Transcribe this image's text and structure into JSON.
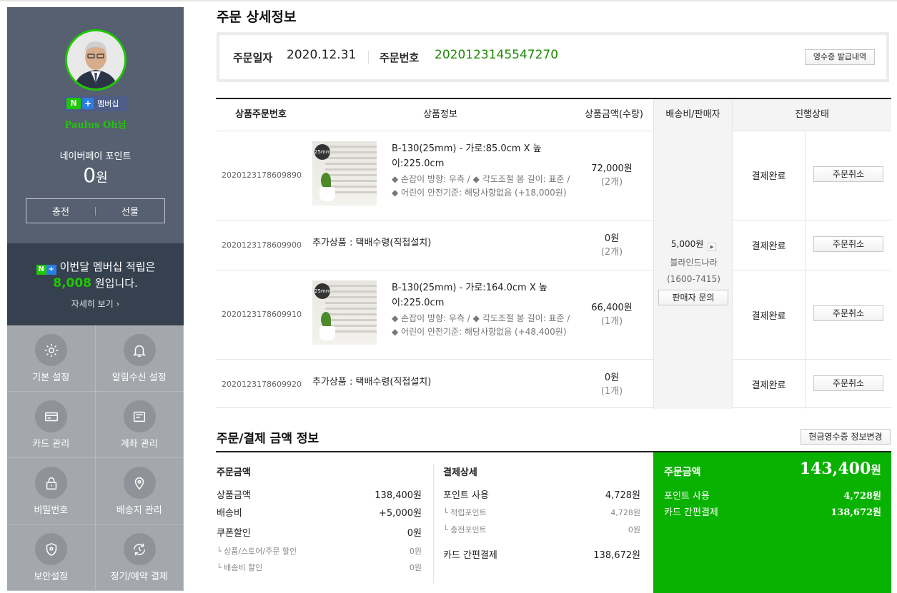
{
  "sidebar": {
    "badge": {
      "n": "N",
      "plus": "+",
      "label": "멤버십"
    },
    "username": "Paulus Oh님",
    "points_label": "네이버페이 포인트",
    "points_value": "0",
    "points_unit": "원",
    "charge": "충전",
    "gift": "선물",
    "membership": {
      "line1": "이번달 멤버십 적립은",
      "amount": "8,008",
      "line2_suffix": "원입니다.",
      "more": "자세히 보기 ›"
    },
    "menu": [
      {
        "label": "기본 설정",
        "icon": "gear-icon"
      },
      {
        "label": "알림수신 설정",
        "icon": "bell-icon"
      },
      {
        "label": "카드 관리",
        "icon": "card-icon"
      },
      {
        "label": "계좌 관리",
        "icon": "account-icon"
      },
      {
        "label": "비밀번호",
        "icon": "lock-icon"
      },
      {
        "label": "배송지 관리",
        "icon": "location-icon"
      },
      {
        "label": "보안설정",
        "icon": "shield-icon"
      },
      {
        "label": "정기/예약 결제",
        "icon": "recurring-icon"
      }
    ]
  },
  "detail": {
    "title": "주문 상세정보",
    "order_date_label": "주문일자",
    "order_date": "2020.12.31",
    "order_no_label": "주문번호",
    "order_no": "2020123145547270",
    "receipt_button": "영수증 발급내역"
  },
  "table": {
    "headers": [
      "상품주문번호",
      "상품정보",
      "상품금액(수량)",
      "배송비/판매자",
      "진행상태"
    ],
    "rows": [
      {
        "no": "2020123178609890",
        "title": "B-130(25mm) - 가로:85.0cm X 높이:225.0cm",
        "options": "◆ 손잡이 방향: 우측 / ◆ 각도조절 봉 길이: 표준 / ◆ 어린이 안전기준: 해당사항없음 (+18,000원)",
        "amount": "72,000원",
        "qty": "(2개)",
        "status": "결제완료",
        "cancel": "주문취소"
      },
      {
        "no": "2020123178609900",
        "desc": "추가상품 : 택배수령(직접설치)",
        "amount": "0원",
        "qty": "(2개)",
        "status": "결제완료",
        "cancel": "주문취소"
      },
      {
        "no": "2020123178609910",
        "title": "B-130(25mm) - 가로:164.0cm X 높이:225.0cm",
        "options": "◆ 손잡이 방향: 우측 / ◆ 각도조절 봉 길이: 표준 / ◆ 어린이 안전기준: 해당사항없음 (+48,400원)",
        "amount": "66,400원",
        "qty": "(1개)",
        "status": "결제완료",
        "cancel": "주문취소"
      },
      {
        "no": "2020123178609920",
        "desc": "추가상품 : 택배수령(직접설치)",
        "amount": "0원",
        "qty": "(1개)",
        "status": "결제완료",
        "cancel": "주문취소"
      }
    ],
    "shipping": {
      "fee": "5,000원",
      "seller": "블라인드나라",
      "phone": "(1600-7415)",
      "inquiry": "판매자 문의"
    }
  },
  "payment": {
    "title": "주문/결제 금액 정보",
    "cash_receipt_button": "현금영수증 정보변경",
    "order": {
      "heading": "주문금액",
      "product_label": "상품금액",
      "product_value": "138,400원",
      "shipping_label": "배송비",
      "shipping_value": "+5,000원",
      "coupon_label": "쿠폰할인",
      "coupon_value": "0원",
      "store_disc_label": "└ 상품/스토어/주문 할인",
      "store_disc_value": "0원",
      "ship_disc_label": "└ 배송비 할인",
      "ship_disc_value": "0원"
    },
    "detail": {
      "heading": "결제상세",
      "point_label": "포인트 사용",
      "point_value": "4,728원",
      "earned_label": "└ 적립포인트",
      "earned_value": "4,728원",
      "charged_label": "└ 충전포인트",
      "charged_value": "0원",
      "card_label": "카드 간편결제",
      "card_value": "138,672원"
    },
    "summary": {
      "label": "주문금액",
      "total": "143,400",
      "total_unit": "원",
      "point_label": "포인트 사용",
      "point_value": "4,728원",
      "card_label": "카드 간편결제",
      "card_value": "138,672원"
    }
  },
  "colors": {
    "accent": "#1ec800",
    "summary_bg": "#09b200",
    "sidebar": "#576070",
    "order_no": "#1a8a00"
  }
}
